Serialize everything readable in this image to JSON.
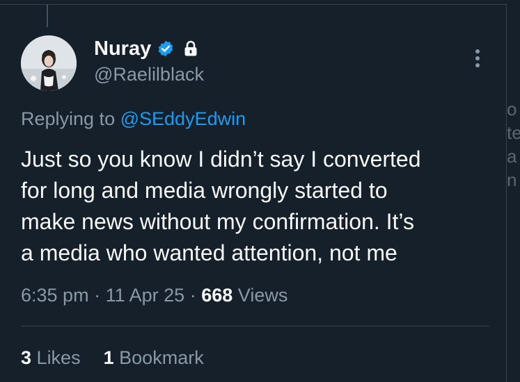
{
  "user": {
    "display_name": "Nuray",
    "handle": "@Raelilblack",
    "verified_icon": "verified-badge-icon",
    "protected_icon": "lock-icon"
  },
  "reply": {
    "prefix": "Replying to",
    "mention": "@SEddyEdwin"
  },
  "tweet": {
    "text": "Just so you know I didn’t say I converted\nfor long and media wrongly started to\nmake news without my confirmation. It’s\na media who wanted attention, not me"
  },
  "meta": {
    "time": "6:35 pm",
    "separator": "·",
    "date": "11 Apr 25",
    "views_count": "668",
    "views_label": "Views"
  },
  "stats": {
    "likes_count": "3",
    "likes_label": "Likes",
    "bookmarks_count": "1",
    "bookmarks_label": "Bookmark"
  },
  "side_fragments": [
    "o",
    "te",
    "a",
    "n"
  ],
  "colors": {
    "background": "#15202b",
    "primary_text": "#f7f9f9",
    "secondary_text": "#8b98a5",
    "accent": "#1d9bf0",
    "border": "#38444d"
  }
}
